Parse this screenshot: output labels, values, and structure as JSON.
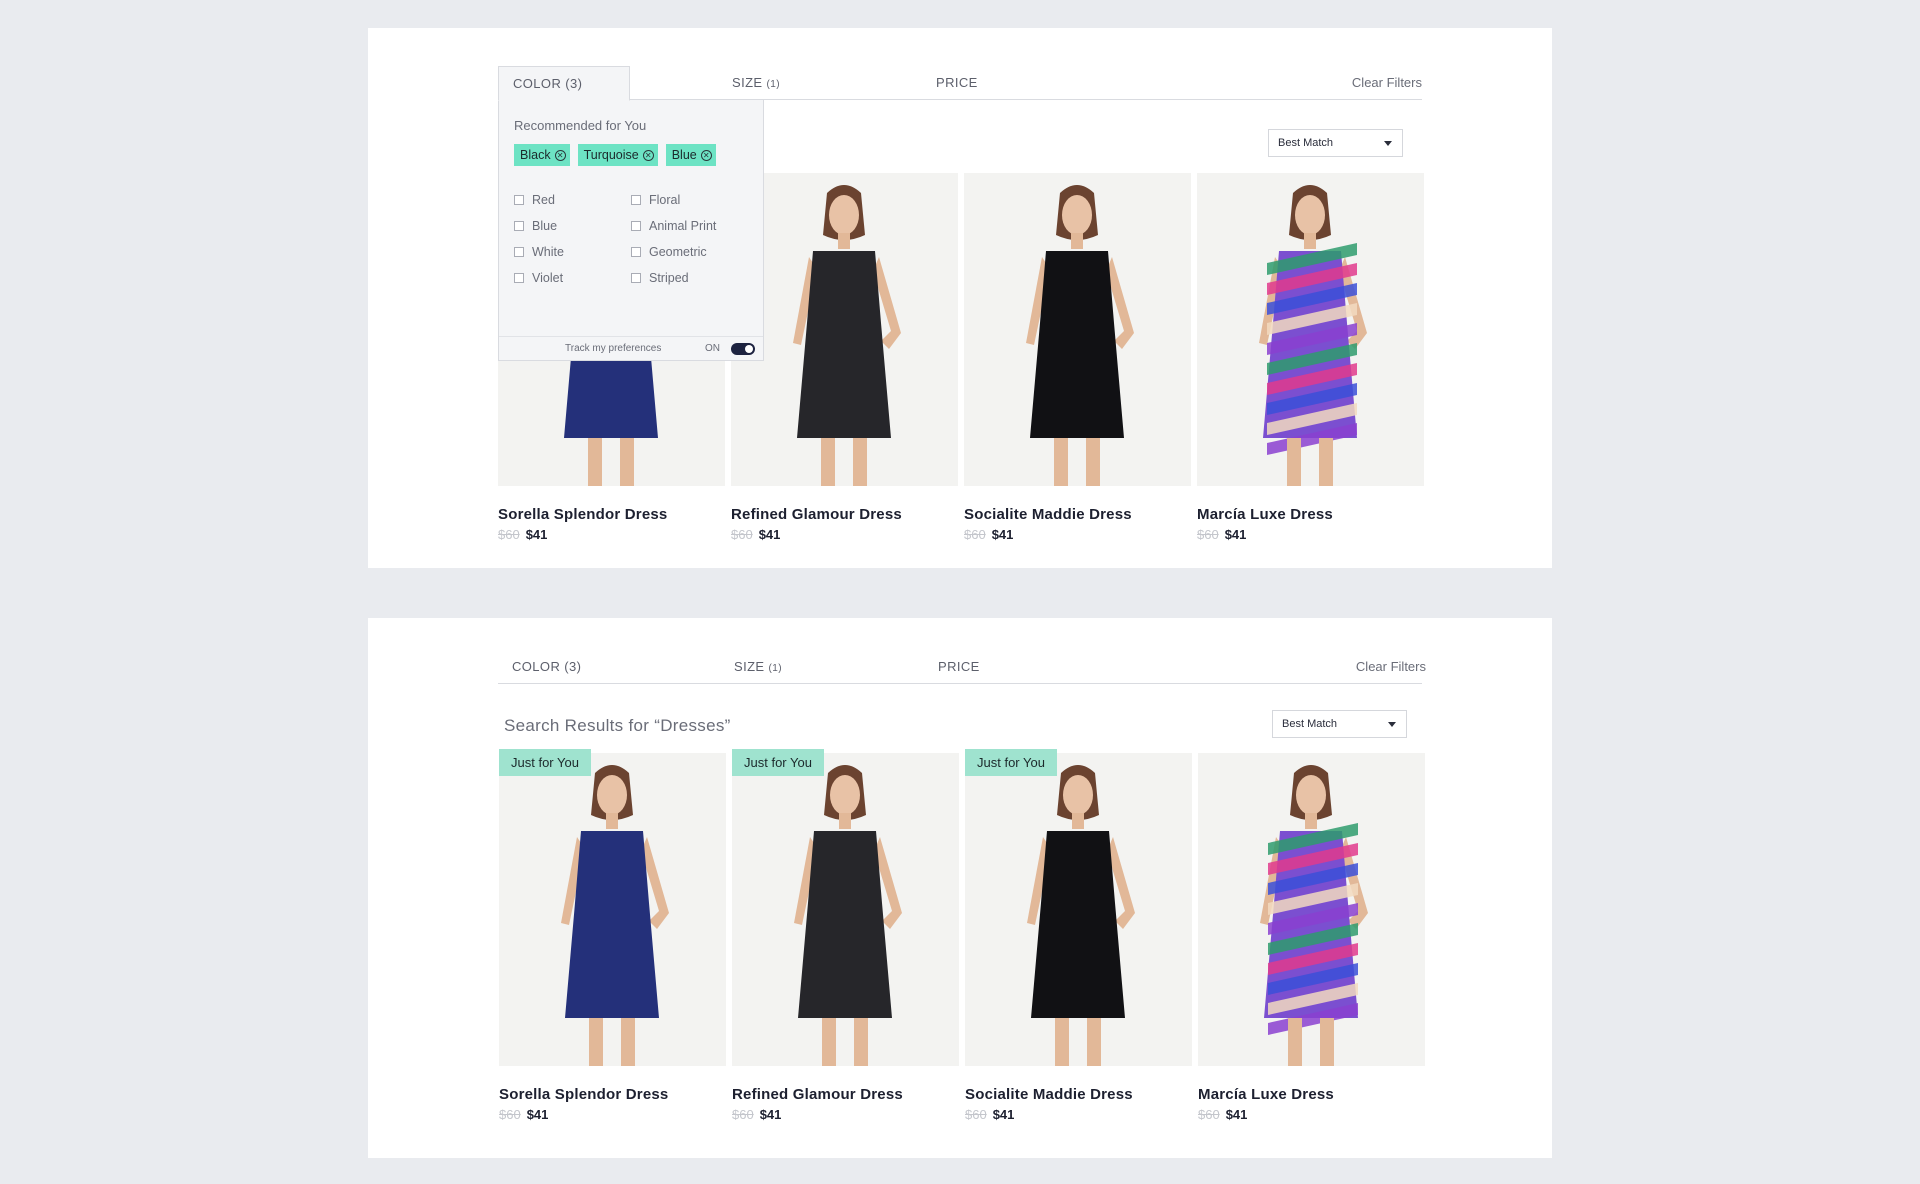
{
  "filters": {
    "color_label": "COLOR (3)",
    "size_label": "SIZE",
    "size_count": "(1)",
    "price_label": "PRICE",
    "clear_label": "Clear Filters"
  },
  "dropdown": {
    "heading": "Recommended for You",
    "chips": [
      "Black",
      "Turquoise",
      "Blue"
    ],
    "options_left": [
      "Red",
      "Blue",
      "White",
      "Violet"
    ],
    "options_right": [
      "Floral",
      "Animal Print",
      "Geometric",
      "Striped"
    ],
    "track_label": "Track my preferences",
    "track_state": "ON"
  },
  "sort": {
    "label": "Best Match"
  },
  "results_title": "Search Results for “Dresses”",
  "badge_label": "Just for You",
  "products": [
    {
      "name": "Sorella Splendor Dress",
      "old_price": "$60",
      "price": "$41",
      "dress_color": "#24307a"
    },
    {
      "name": "Refined Glamour Dress",
      "old_price": "$60",
      "price": "$41",
      "dress_color": "#26262a"
    },
    {
      "name": "Socialite Maddie Dress",
      "old_price": "$60",
      "price": "$41",
      "dress_color": "#111114"
    },
    {
      "name": "Marcía Luxe Dress",
      "old_price": "$60",
      "price": "$41",
      "dress_color": "#7b4fd0"
    }
  ],
  "colors": {
    "accent": "#6de3c4",
    "badge": "#9fe3cf",
    "page_bg": "#e9ebef"
  }
}
